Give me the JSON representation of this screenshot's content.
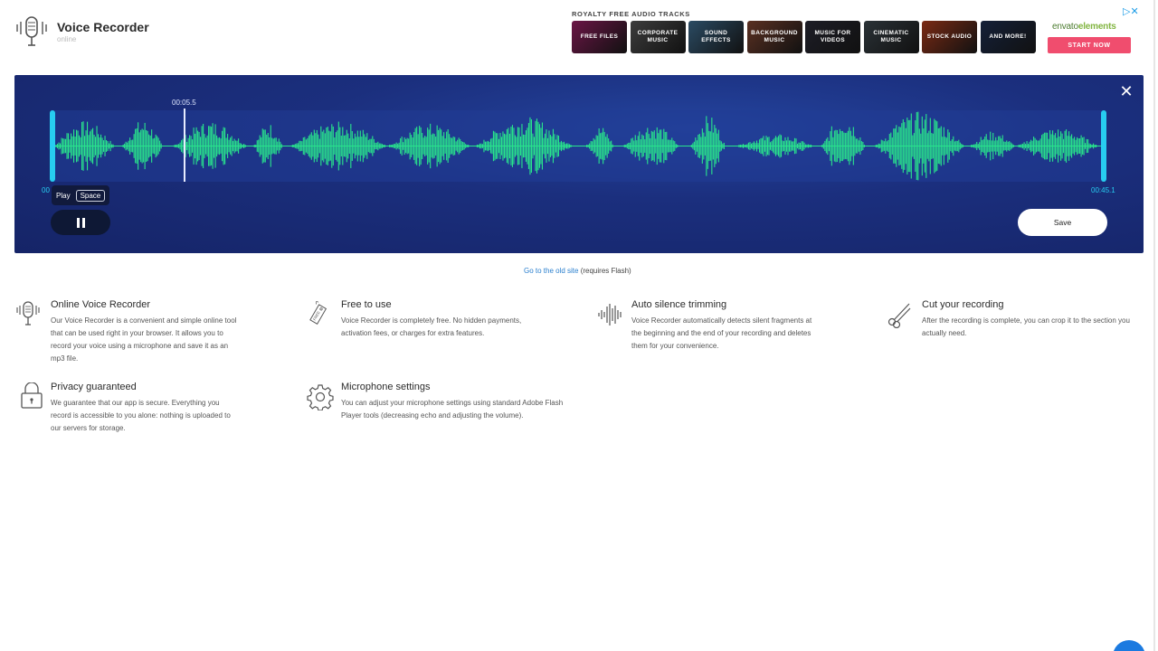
{
  "header": {
    "title": "Voice Recorder",
    "subtitle": "online",
    "logo_icon": "microphone-icon"
  },
  "ad": {
    "heading": "ROYALTY FREE AUDIO TRACKS",
    "tiles": [
      {
        "label": "FREE FILES",
        "color": "#6a1545"
      },
      {
        "label": "CORPORATE MUSIC",
        "color": "#3d3d3d"
      },
      {
        "label": "SOUND EFFECTS",
        "color": "#2b4b63"
      },
      {
        "label": "BACKGROUND MUSIC",
        "color": "#5a3022"
      },
      {
        "label": "MUSIC FOR VIDEOS",
        "color": "#1d1d26"
      },
      {
        "label": "CINEMATIC MUSIC",
        "color": "#2a3136"
      },
      {
        "label": "STOCK AUDIO",
        "color": "#7a2a14"
      },
      {
        "label": "AND MORE!",
        "color": "#142038"
      }
    ],
    "brand_prefix": "envato",
    "brand_suffix": "elements",
    "cta": "START NOW",
    "close_glyph": "▷✕"
  },
  "player": {
    "current_time": "00:05.5",
    "start_time": "00",
    "end_time": "00:45.1",
    "tooltip_label": "Play",
    "tooltip_key": "Space",
    "save_label": "Save",
    "close_glyph": "✕",
    "playhead_fraction": 0.122,
    "wave_color": "#29e58c",
    "accent_color": "#27cdf0"
  },
  "old_site": {
    "link_text": "Go to the old site",
    "suffix": " (requires Flash)"
  },
  "features": [
    {
      "title": "Online Voice Recorder",
      "desc": "Our Voice Recorder is a convenient and simple online tool that can be used right in your browser. It allows you to record your voice using a microphone and save it as an mp3 file.",
      "icon": "microphone-icon"
    },
    {
      "title": "Free to use",
      "desc": "Voice Recorder is completely free. No hidden payments, activation fees, or charges for extra features.",
      "icon": "free-tag-icon"
    },
    {
      "title": "Auto silence trimming",
      "desc": "Voice Recorder automatically detects silent fragments at the beginning and the end of your recording and deletes them for your convenience.",
      "icon": "soundwave-icon"
    },
    {
      "title": "Cut your recording",
      "desc": "After the recording is complete, you can crop it to the section you actually need.",
      "icon": "scissors-icon"
    },
    {
      "title": "Privacy guaranteed",
      "desc": "We guarantee that our app is secure. Everything you record is accessible to you alone: nothing is uploaded to our servers for storage.",
      "icon": "lock-icon"
    },
    {
      "title": "Microphone settings",
      "desc": "You can adjust your microphone settings using standard Adobe Flash Player tools (decreasing echo and adjusting the volume).",
      "icon": "gear-icon"
    }
  ]
}
